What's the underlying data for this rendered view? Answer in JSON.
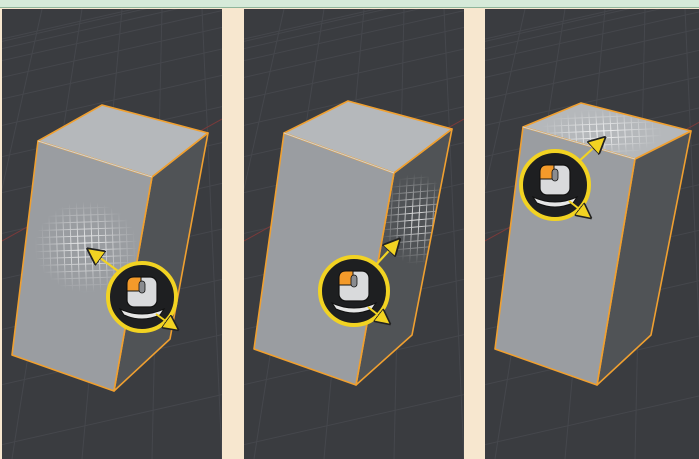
{
  "title": "",
  "colors": {
    "page_background": "#f7e7cf",
    "top_bar": "#d6ead9",
    "viewport_background": "#3a3c40",
    "grid_line": "#45474c",
    "axis_red": "#7a3a3a",
    "selection_outline": "#f0a030",
    "face_front": "#9a9da1",
    "face_top": "#b5b8bb",
    "face_side": "#505356",
    "mouse_ring": "#f2d322",
    "arrow": "#f2d322"
  },
  "panels": [
    {
      "id": "front-face",
      "hovered_face": "front",
      "mouse_icon": "mouse-left-button-icon",
      "direction_icon": "arrow-upper-left-icon"
    },
    {
      "id": "side-face",
      "hovered_face": "side",
      "mouse_icon": "mouse-left-button-icon",
      "direction_icon": "arrow-upper-right-icon"
    },
    {
      "id": "top-face",
      "hovered_face": "top",
      "mouse_icon": "mouse-left-button-icon",
      "direction_icon": "arrow-upper-right-icon"
    }
  ]
}
